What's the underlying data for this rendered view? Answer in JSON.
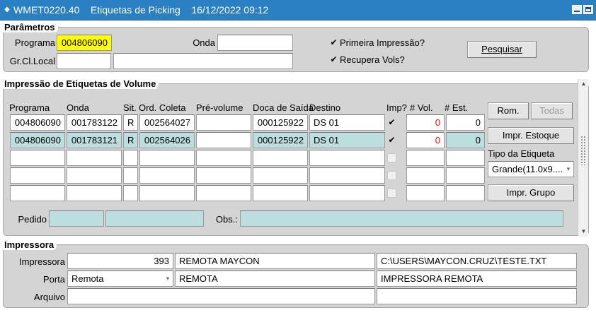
{
  "titlebar": {
    "title": "WMET0220.40    Etiquetas de Picking    16/12/2022 09:12"
  },
  "parametros": {
    "section_title": "Parâmetros",
    "programa_label": "Programa",
    "programa_value": "004806090",
    "onda_label": "Onda",
    "onda_value": "",
    "grcl_label": "Gr.Cl.Local",
    "grcl_value1": "",
    "grcl_value2": "",
    "primeira_impressao_label": "Primeira Impressão?",
    "primeira_impressao_checked": true,
    "recupera_vols_label": "Recupera Vols?",
    "recupera_vols_checked": true,
    "pesquisar_label": "Pesquisar"
  },
  "impressao": {
    "section_title": "Impressão de Etiquetas de Volume",
    "columns": [
      "Programa",
      "Onda",
      "Sit.",
      "Ord. Coleta",
      "Pré-volume",
      "Doca de Saída",
      "Destino",
      "Imp?",
      "# Vol.",
      "# Est."
    ],
    "rows": [
      {
        "programa": "004806090",
        "onda": "001783122",
        "sit": "R",
        "ord_coleta": "002564027",
        "pre_volume": "",
        "doca": "000125922",
        "destino": "DS 01",
        "imp": true,
        "vol": "0",
        "est": "0"
      },
      {
        "programa": "004806090",
        "onda": "001783121",
        "sit": "R",
        "ord_coleta": "002564026",
        "pre_volume": "",
        "doca": "000125922",
        "destino": "DS 01",
        "imp": true,
        "vol": "0",
        "est": "0"
      },
      {
        "programa": "",
        "onda": "",
        "sit": "",
        "ord_coleta": "",
        "pre_volume": "",
        "doca": "",
        "destino": "",
        "imp": false,
        "vol": "",
        "est": ""
      },
      {
        "programa": "",
        "onda": "",
        "sit": "",
        "ord_coleta": "",
        "pre_volume": "",
        "doca": "",
        "destino": "",
        "imp": false,
        "vol": "",
        "est": ""
      },
      {
        "programa": "",
        "onda": "",
        "sit": "",
        "ord_coleta": "",
        "pre_volume": "",
        "doca": "",
        "destino": "",
        "imp": false,
        "vol": "",
        "est": ""
      }
    ],
    "rom_label": "Rom.",
    "todas_label": "Todas",
    "impr_estoque_label": "Impr. Estoque",
    "tipo_etiqueta_label": "Tipo da Etiqueta",
    "tipo_etiqueta_value": "Grande(11.0x9....",
    "impr_grupo_label": "Impr. Grupo",
    "pedido_label": "Pedido",
    "pedido_value1": "",
    "pedido_value2": "",
    "obs_label": "Obs.:",
    "obs_value": ""
  },
  "impressora": {
    "section_title": "Impressora",
    "impressora_label": "Impressora",
    "impressora_code": "393",
    "impressora_name": "REMOTA MAYCON",
    "impressora_path": "C:\\USERS\\MAYCON.CRUZ\\TESTE.TXT",
    "porta_label": "Porta",
    "porta_value": "Remota",
    "porta_desc": "REMOTA",
    "porta_desc2": "IMPRESSORA REMOTA",
    "arquivo_label": "Arquivo",
    "arquivo_value": "",
    "arquivo_value2": ""
  },
  "colors": {
    "titlebar": "#2b7fc3",
    "panel": "#d4d4d4",
    "highlight_yellow": "#ffff00",
    "row_teal": "#bcdede",
    "zero_red": "#ff0000"
  }
}
